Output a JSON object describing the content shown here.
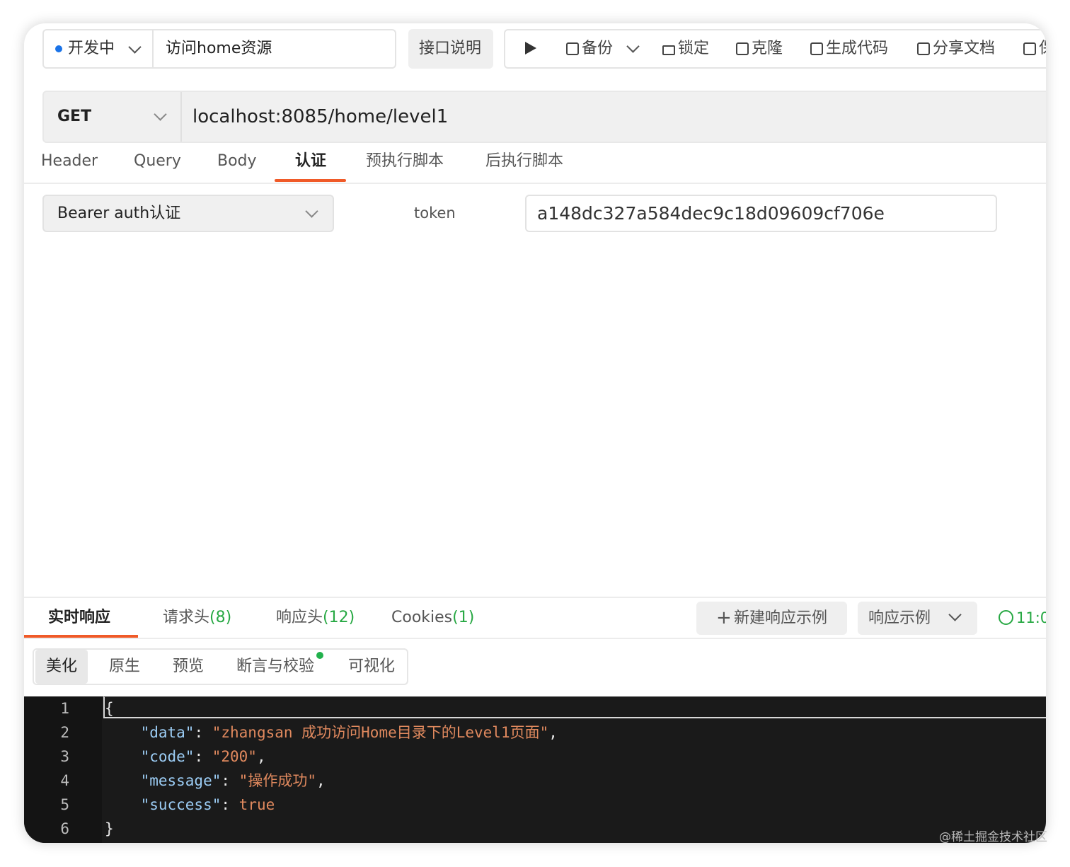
{
  "toolbar": {
    "status_label": "开发中",
    "api_name": "访问home资源",
    "doc_button": "接口说明",
    "actions": {
      "backup": "备份",
      "lock": "锁定",
      "clone": "克隆",
      "generate_code": "生成代码",
      "share_doc": "分享文档",
      "more_partial": "保"
    }
  },
  "request": {
    "method": "GET",
    "url": "localhost:8085/home/level1"
  },
  "request_tabs": [
    "Header",
    "Query",
    "Body",
    "认证",
    "预执行脚本",
    "后执行脚本"
  ],
  "auth": {
    "type": "Bearer auth认证",
    "token_label": "token",
    "token_value": "a148dc327a584dec9c18d09609cf706e"
  },
  "response_tabs": {
    "realtime": "实时响应",
    "req_headers": "请求头",
    "req_headers_count": "(8)",
    "resp_headers": "响应头",
    "resp_headers_count": "(12)",
    "cookies": "Cookies",
    "cookies_count": "(1)",
    "new_example": "新建响应示例",
    "examples": "响应示例",
    "time": "11:0"
  },
  "view_tabs": [
    "美化",
    "原生",
    "预览",
    "断言与校验",
    "可视化"
  ],
  "code": {
    "line_numbers": [
      "1",
      "2",
      "3",
      "4",
      "5",
      "6"
    ],
    "open_brace": "{",
    "close_brace": "}",
    "data_key": "\"data\"",
    "data_value": "\"zhangsan 成功访问Home目录下的Level1页面\"",
    "code_key": "\"code\"",
    "code_value": "\"200\"",
    "message_key": "\"message\"",
    "message_value": "\"操作成功\"",
    "success_key": "\"success\"",
    "success_value": "true"
  },
  "watermark": "@稀土掘金技术社区",
  "colors": {
    "accent": "#f05a28",
    "count_green": "#27a843",
    "status_dot": "#1a73e8",
    "code_bg": "#1a1a1a",
    "json_key": "#9ccdf5",
    "json_string": "#e0895e"
  }
}
